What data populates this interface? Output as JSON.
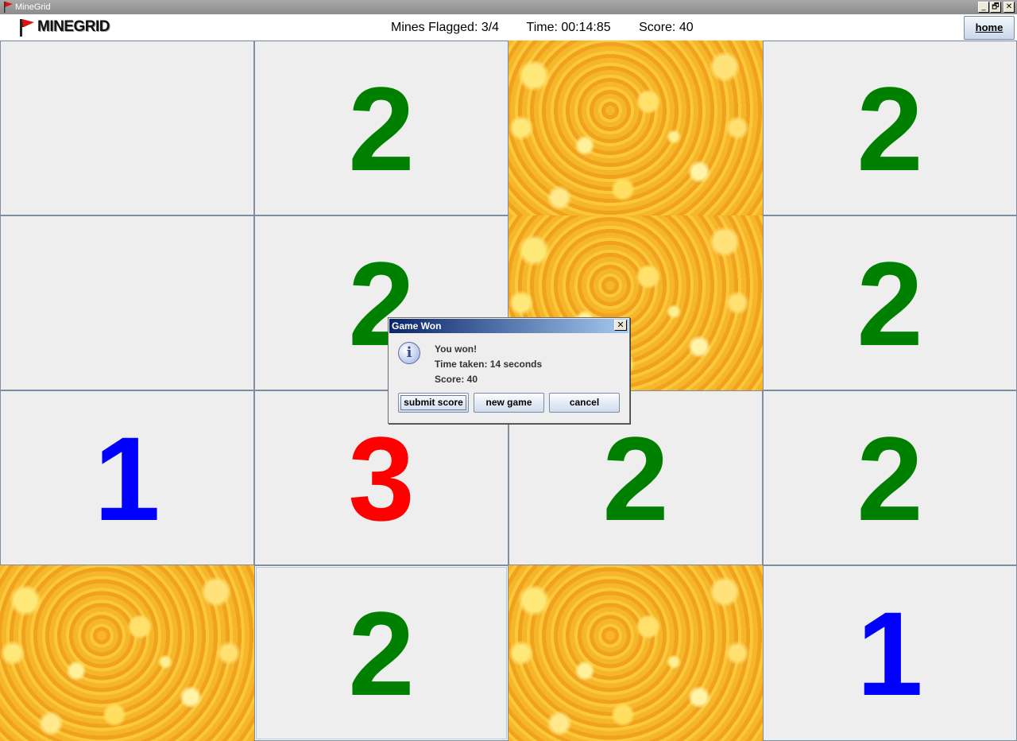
{
  "window": {
    "title": "MineGrid",
    "minimize": "_",
    "maximize": "🗗",
    "close": "✕"
  },
  "header": {
    "logo_text": "MINEGRID",
    "mines_flagged": "Mines Flagged: 3/4",
    "time": "Time: 00:14:85",
    "score": "Score: 40",
    "home_label": "home"
  },
  "colors": {
    "one": "#0000ff",
    "two": "#008000",
    "three": "#ff0000",
    "mine": "#f2a823"
  },
  "grid": {
    "rows": 4,
    "cols": 4,
    "cells": [
      {
        "state": "revealed",
        "value": ""
      },
      {
        "state": "revealed",
        "value": "2"
      },
      {
        "state": "mine",
        "value": ""
      },
      {
        "state": "revealed",
        "value": "2"
      },
      {
        "state": "revealed",
        "value": ""
      },
      {
        "state": "revealed",
        "value": "2"
      },
      {
        "state": "mine",
        "value": ""
      },
      {
        "state": "revealed",
        "value": "2"
      },
      {
        "state": "revealed",
        "value": "1"
      },
      {
        "state": "revealed",
        "value": "3"
      },
      {
        "state": "revealed",
        "value": "2"
      },
      {
        "state": "revealed",
        "value": "2"
      },
      {
        "state": "mine",
        "value": ""
      },
      {
        "state": "revealed",
        "value": "2"
      },
      {
        "state": "mine",
        "value": ""
      },
      {
        "state": "revealed",
        "value": "1"
      }
    ]
  },
  "dialog": {
    "title": "Game Won",
    "close": "✕",
    "icon": "info-icon",
    "icon_glyph": "i",
    "line1": "You won!",
    "line2": "Time taken: 14 seconds",
    "line3": "Score: 40",
    "submit_label": "submit score",
    "new_game_label": "new game",
    "cancel_label": "cancel"
  }
}
